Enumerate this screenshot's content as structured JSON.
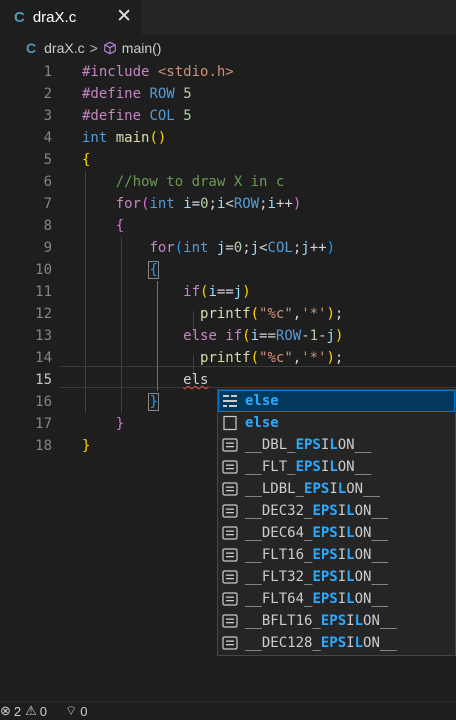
{
  "tab": {
    "icon": "C",
    "title": "draX.c",
    "close": "✕"
  },
  "breadcrumb": {
    "icon": "C",
    "file": "draX.c",
    "separator": ">",
    "symbol": "main()"
  },
  "editor": {
    "active_line": 15,
    "lines": [
      [
        [
          "inc",
          "#include"
        ],
        [
          "plain",
          " "
        ],
        [
          "str",
          "<stdio.h>"
        ]
      ],
      [
        [
          "inc",
          "#define"
        ],
        [
          "plain",
          " "
        ],
        [
          "mac",
          "ROW"
        ],
        [
          "plain",
          " "
        ],
        [
          "num",
          "5"
        ]
      ],
      [
        [
          "inc",
          "#define"
        ],
        [
          "plain",
          " "
        ],
        [
          "mac",
          "COL"
        ],
        [
          "plain",
          " "
        ],
        [
          "num",
          "5"
        ]
      ],
      [
        [
          "kw",
          "int"
        ],
        [
          "plain",
          " "
        ],
        [
          "fn",
          "main"
        ],
        [
          "b1",
          "()"
        ]
      ],
      [
        [
          "b1",
          "{"
        ]
      ],
      [
        [
          "plain",
          "    "
        ],
        [
          "cmt",
          "//how to draw X in c"
        ]
      ],
      [
        [
          "plain",
          "    "
        ],
        [
          "ctl",
          "for"
        ],
        [
          "b2",
          "("
        ],
        [
          "kw",
          "int"
        ],
        [
          "plain",
          " "
        ],
        [
          "var",
          "i"
        ],
        [
          "plain",
          "="
        ],
        [
          "num",
          "0"
        ],
        [
          "plain",
          ";"
        ],
        [
          "var",
          "i"
        ],
        [
          "plain",
          "<"
        ],
        [
          "mac",
          "ROW"
        ],
        [
          "plain",
          ";"
        ],
        [
          "var",
          "i"
        ],
        [
          "plain",
          "++"
        ],
        [
          "b2",
          ")"
        ]
      ],
      [
        [
          "plain",
          "    "
        ],
        [
          "b2",
          "{"
        ]
      ],
      [
        [
          "plain",
          "        "
        ],
        [
          "ctl",
          "for"
        ],
        [
          "b3",
          "("
        ],
        [
          "kw",
          "int"
        ],
        [
          "plain",
          " "
        ],
        [
          "var",
          "j"
        ],
        [
          "plain",
          "="
        ],
        [
          "num",
          "0"
        ],
        [
          "plain",
          ";"
        ],
        [
          "var",
          "j"
        ],
        [
          "plain",
          "<"
        ],
        [
          "mac",
          "COL"
        ],
        [
          "plain",
          ";"
        ],
        [
          "var",
          "j"
        ],
        [
          "plain",
          "++"
        ],
        [
          "b3",
          ")"
        ]
      ],
      [
        [
          "plain",
          "        "
        ],
        [
          "b3box",
          "{"
        ]
      ],
      [
        [
          "plain",
          "            "
        ],
        [
          "ctl",
          "if"
        ],
        [
          "b1",
          "("
        ],
        [
          "var",
          "i"
        ],
        [
          "plain",
          "=="
        ],
        [
          "var",
          "j"
        ],
        [
          "b1",
          ")"
        ]
      ],
      [
        [
          "plain",
          "              "
        ],
        [
          "fn",
          "printf"
        ],
        [
          "b1",
          "("
        ],
        [
          "str",
          "\"%c\""
        ],
        [
          "plain",
          ","
        ],
        [
          "str",
          "'*'"
        ],
        [
          "b1",
          ")"
        ],
        [
          "plain",
          ";"
        ]
      ],
      [
        [
          "plain",
          "            "
        ],
        [
          "ctl",
          "else"
        ],
        [
          "plain",
          " "
        ],
        [
          "ctl",
          "if"
        ],
        [
          "b1",
          "("
        ],
        [
          "var",
          "i"
        ],
        [
          "plain",
          "=="
        ],
        [
          "mac",
          "ROW"
        ],
        [
          "plain",
          "-"
        ],
        [
          "num",
          "1"
        ],
        [
          "plain",
          "-"
        ],
        [
          "var",
          "j"
        ],
        [
          "b1",
          ")"
        ]
      ],
      [
        [
          "plain",
          "              "
        ],
        [
          "fn",
          "printf"
        ],
        [
          "b1",
          "("
        ],
        [
          "str",
          "\"%c\""
        ],
        [
          "plain",
          ","
        ],
        [
          "str",
          "'*'"
        ],
        [
          "b1",
          ")"
        ],
        [
          "plain",
          ";"
        ]
      ],
      [
        [
          "plain",
          "            "
        ],
        [
          "squig",
          "els"
        ]
      ],
      [
        [
          "plain",
          "        "
        ],
        [
          "b3box",
          "}"
        ]
      ],
      [
        [
          "plain",
          "    "
        ],
        [
          "b2",
          "}"
        ]
      ],
      [
        [
          "b1",
          "}"
        ]
      ]
    ]
  },
  "suggestions": {
    "selected_index": 0,
    "items": [
      {
        "icon": "snippet-icon",
        "pre": "",
        "match": "else",
        "post": ""
      },
      {
        "icon": "keyword-icon",
        "pre": "",
        "match": "else",
        "post": ""
      },
      {
        "icon": "constant-icon",
        "pre": "__DBL_",
        "match": "EPS",
        "post": "I",
        "match2": "L",
        "post2": "ON__"
      },
      {
        "icon": "constant-icon",
        "pre": "__FLT_",
        "match": "EPS",
        "post": "I",
        "match2": "L",
        "post2": "ON__"
      },
      {
        "icon": "constant-icon",
        "pre": "__LDBL_",
        "match": "EPS",
        "post": "I",
        "match2": "L",
        "post2": "ON__"
      },
      {
        "icon": "constant-icon",
        "pre": "__DEC32_",
        "match": "EPS",
        "post": "I",
        "match2": "L",
        "post2": "ON__"
      },
      {
        "icon": "constant-icon",
        "pre": "__DEC64_",
        "match": "EPS",
        "post": "I",
        "match2": "L",
        "post2": "ON__"
      },
      {
        "icon": "constant-icon",
        "pre": "__FLT16_",
        "match": "EPS",
        "post": "I",
        "match2": "L",
        "post2": "ON__"
      },
      {
        "icon": "constant-icon",
        "pre": "__FLT32_",
        "match": "EPS",
        "post": "I",
        "match2": "L",
        "post2": "ON__"
      },
      {
        "icon": "constant-icon",
        "pre": "__FLT64_",
        "match": "EPS",
        "post": "I",
        "match2": "L",
        "post2": "ON__"
      },
      {
        "icon": "constant-icon",
        "pre": "__BFLT16_",
        "match": "EPS",
        "post": "I",
        "match2": "L",
        "post2": "ON__"
      },
      {
        "icon": "constant-icon",
        "pre": "__DEC128_",
        "match": "EPS",
        "post": "I",
        "match2": "L",
        "post2": "ON__"
      }
    ]
  },
  "status": {
    "errors": "2",
    "warnings": "0",
    "ports": "0"
  }
}
